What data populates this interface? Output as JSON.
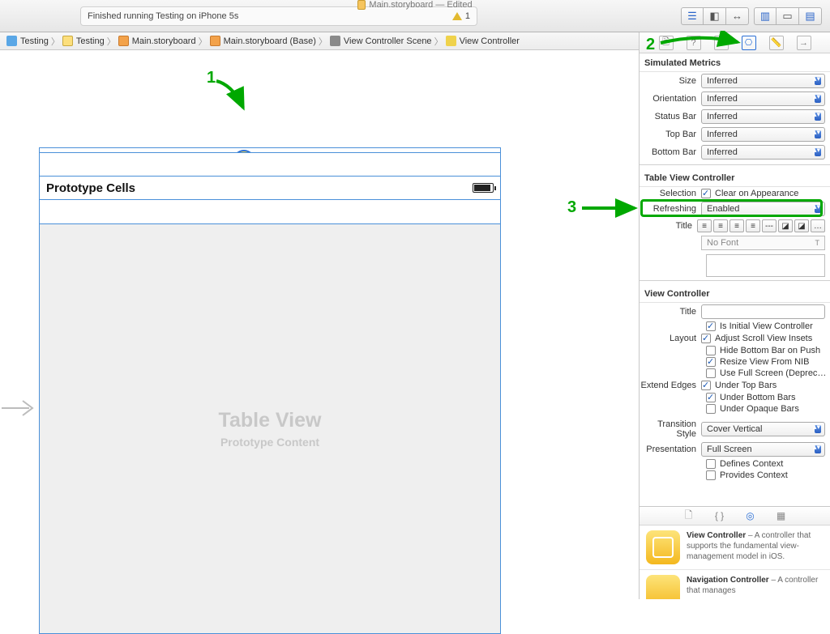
{
  "titlebar": {
    "text": "Main.storyboard — Edited"
  },
  "status": {
    "text": "Finished running Testing on iPhone 5s",
    "warn_count": "1"
  },
  "breadcrumb": [
    "Testing",
    "Testing",
    "Main.storyboard",
    "Main.storyboard (Base)",
    "View Controller Scene",
    "View Controller"
  ],
  "canvas": {
    "cells_header": "Prototype Cells",
    "table_title": "Table View",
    "table_sub": "Prototype Content"
  },
  "annotations": {
    "one": "1",
    "two": "2",
    "three": "3"
  },
  "inspector": {
    "sim_metrics": {
      "header": "Simulated Metrics",
      "size_label": "Size",
      "size_value": "Inferred",
      "orientation_label": "Orientation",
      "orientation_value": "Inferred",
      "statusbar_label": "Status Bar",
      "statusbar_value": "Inferred",
      "topbar_label": "Top Bar",
      "topbar_value": "Inferred",
      "bottombar_label": "Bottom Bar",
      "bottombar_value": "Inferred"
    },
    "tvc": {
      "header": "Table View Controller",
      "selection_label": "Selection",
      "selection_text": "Clear on Appearance",
      "refreshing_label": "Refreshing",
      "refreshing_value": "Enabled",
      "title_label": "Title",
      "nofont": "No Font"
    },
    "vc": {
      "header": "View Controller",
      "title_label": "Title",
      "initial_text": "Is Initial View Controller",
      "layout_label": "Layout",
      "adjust_text": "Adjust Scroll View Insets",
      "hidebb_text": "Hide Bottom Bar on Push",
      "resize_text": "Resize View From NIB",
      "fullscreen_text": "Use Full Screen (Deprec…",
      "edges_label": "Extend Edges",
      "undertop_text": "Under Top Bars",
      "underbottom_text": "Under Bottom Bars",
      "underopaque_text": "Under Opaque Bars",
      "transition_label": "Transition Style",
      "transition_value": "Cover Vertical",
      "presentation_label": "Presentation",
      "presentation_value": "Full Screen",
      "defines_text": "Defines Context",
      "provides_text": "Provides Context"
    }
  },
  "library": {
    "vc_title": "View Controller",
    "vc_desc": " – A controller that supports the fundamental view-management model in iOS.",
    "nc_title": "Navigation Controller",
    "nc_desc": " – A controller that manages"
  }
}
